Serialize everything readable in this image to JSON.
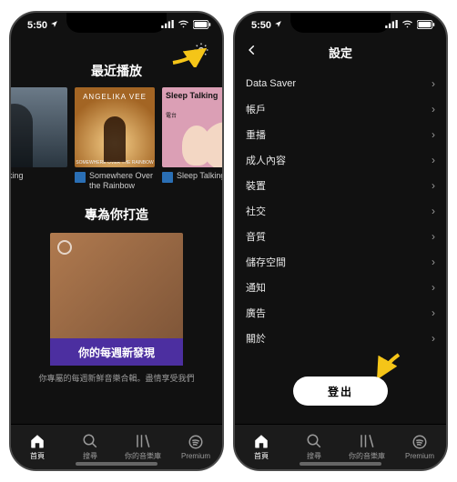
{
  "status": {
    "time": "5:50",
    "signal": "•ıll",
    "wifi": "wifi",
    "battery": "batt"
  },
  "home": {
    "recent_title": "最近播放",
    "cards": [
      {
        "caption": "alking",
        "cover_label": "",
        "cover_sub": ""
      },
      {
        "caption": "Somewhere Over the Rainbow",
        "cover_label": "ANGELIKA VEE",
        "cover_sub": "SOMEWHERE OVER THE RAINBOW"
      },
      {
        "caption": "Sleep Talking Ra",
        "cover_label": "Sleep Talking",
        "cover_sub": "電台"
      }
    ],
    "made_title": "專為你打造",
    "big_card_label": "你的每週新發現",
    "description": "你專屬的每週新鮮音樂合輯。盡情享受我們"
  },
  "settings": {
    "title": "設定",
    "items": [
      "Data Saver",
      "帳戶",
      "重播",
      "成人內容",
      "裝置",
      "社交",
      "音質",
      "儲存空間",
      "通知",
      "廣告",
      "關於"
    ],
    "logout": "登出"
  },
  "tabs": {
    "home": "首頁",
    "search": "搜尋",
    "library": "你的音樂庫",
    "premium": "Premium"
  }
}
